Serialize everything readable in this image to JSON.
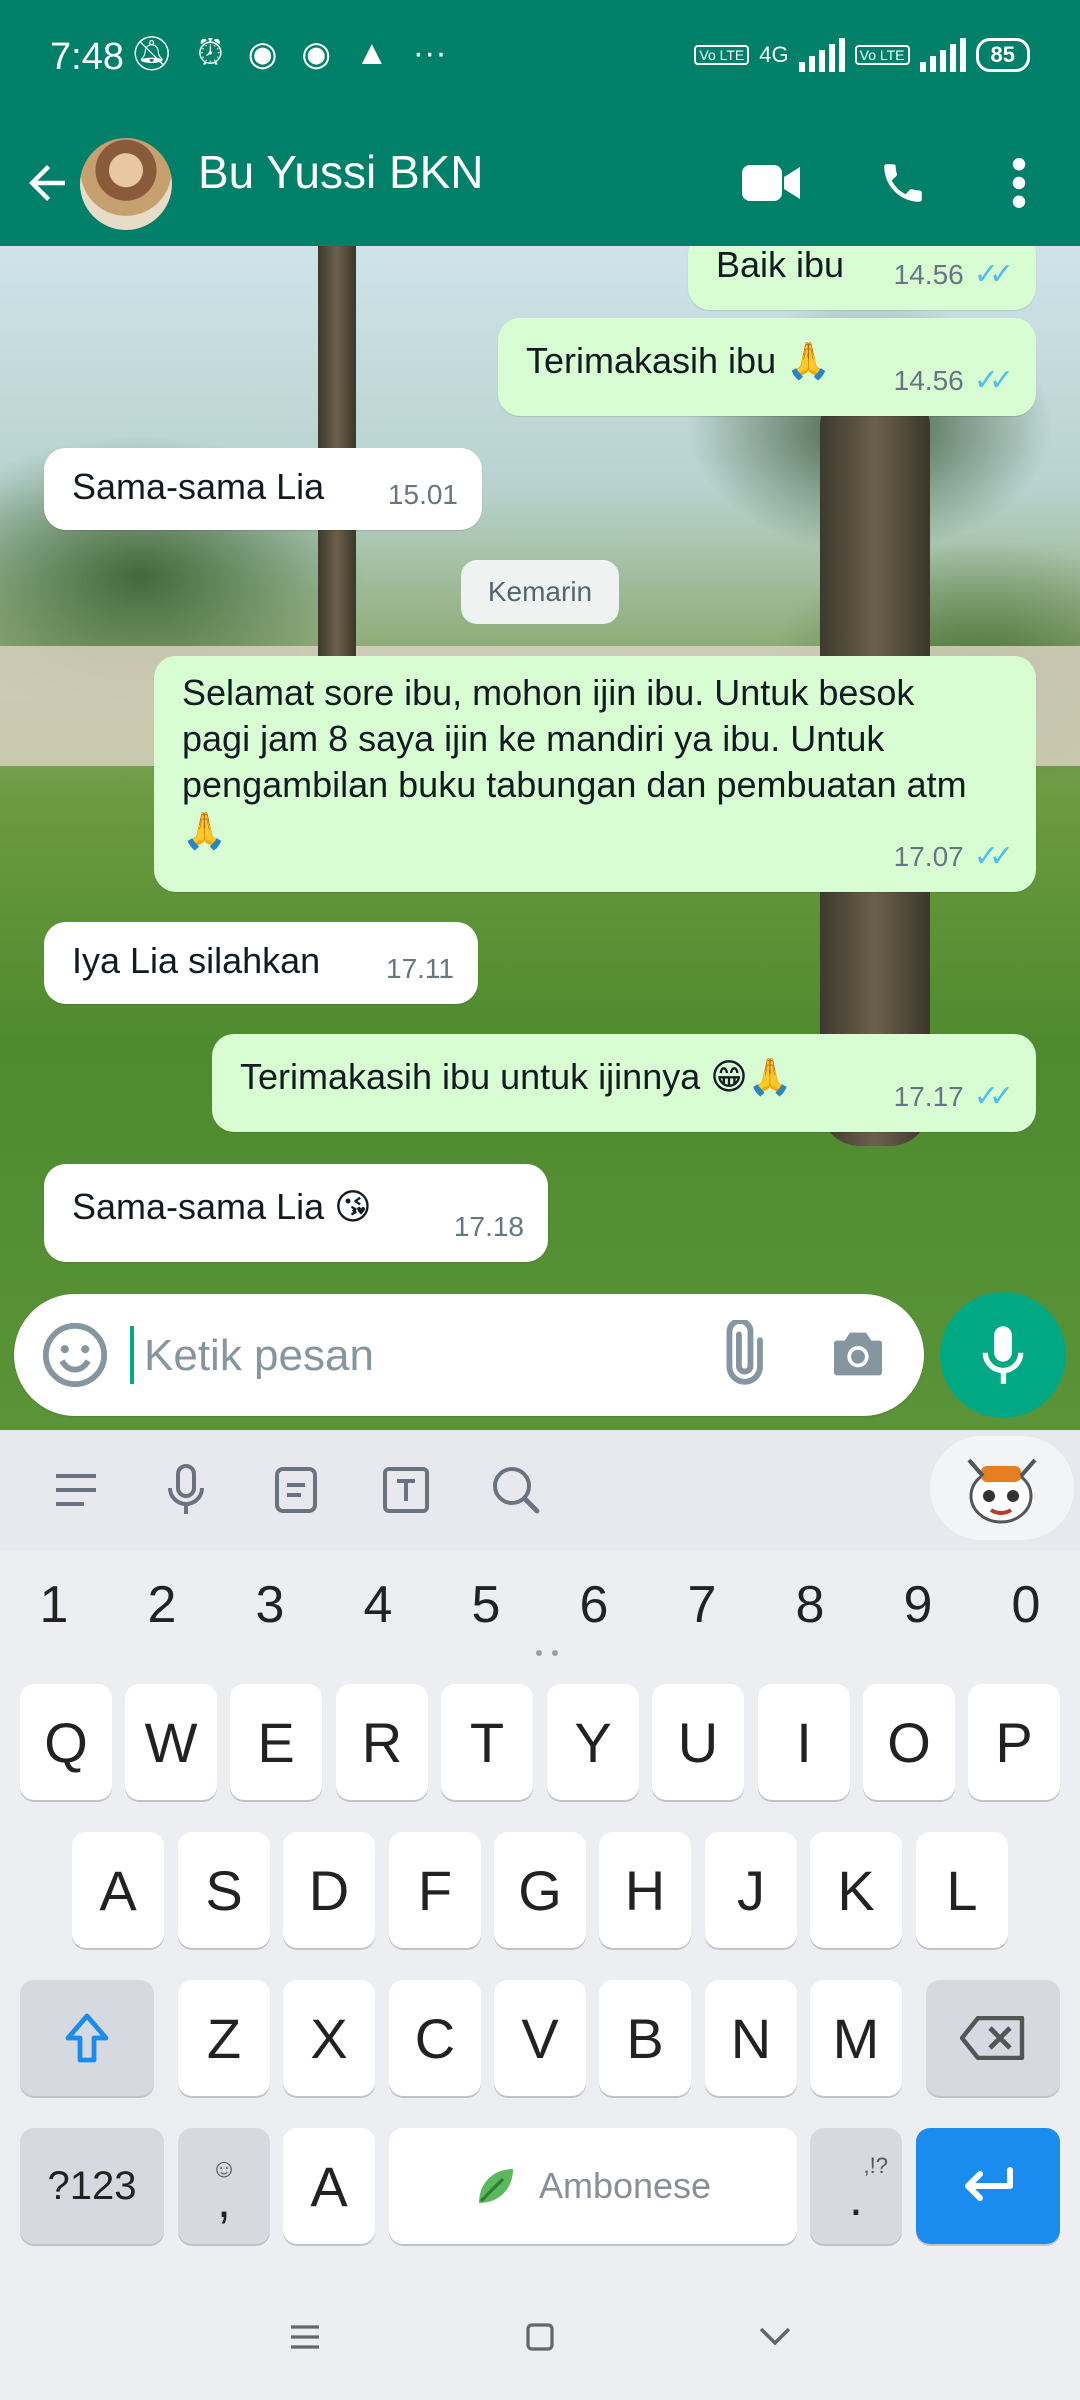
{
  "status": {
    "time": "7:48",
    "icons": [
      "mute-icon",
      "alarm-icon",
      "chrome-icon",
      "chrome-icon",
      "rocket-icon",
      "more-dots-icon"
    ],
    "network": "4G",
    "lte_label": "Vo LTE",
    "battery": "85"
  },
  "header": {
    "contact_name": "Bu Yussi BKN",
    "color": "#008069"
  },
  "messages": [
    {
      "direction": "out",
      "text": "Baik ibu",
      "time": "14.56",
      "read": true
    },
    {
      "direction": "out",
      "text": "Terimakasih ibu 🙏",
      "time": "14.56",
      "read": true
    },
    {
      "direction": "in",
      "text": "Sama-sama Lia",
      "time": "15.01"
    },
    {
      "direction": "out",
      "text": "Selamat sore ibu, mohon ijin ibu. Untuk besok pagi jam 8 saya ijin ke mandiri ya ibu. Untuk pengambilan buku tabungan dan pembuatan atm 🙏",
      "time": "17.07",
      "read": true
    },
    {
      "direction": "in",
      "text": "Iya Lia silahkan",
      "time": "17.11"
    },
    {
      "direction": "out",
      "text": "Terimakasih ibu untuk ijinnya 😁🙏",
      "time": "17.17",
      "read": true
    },
    {
      "direction": "in",
      "text": "Sama-sama Lia 😘",
      "time": "17.18"
    }
  ],
  "date_divider": "Kemarin",
  "composer": {
    "placeholder": "Ketik pesan",
    "value": ""
  },
  "keyboard": {
    "numbers": [
      "1",
      "2",
      "3",
      "4",
      "5",
      "6",
      "7",
      "8",
      "9",
      "0"
    ],
    "row1": [
      "Q",
      "W",
      "E",
      "R",
      "T",
      "Y",
      "U",
      "I",
      "O",
      "P"
    ],
    "row2": [
      "A",
      "S",
      "D",
      "F",
      "G",
      "H",
      "J",
      "K",
      "L"
    ],
    "row3": [
      "Z",
      "X",
      "C",
      "V",
      "B",
      "N",
      "M"
    ],
    "symbols_key": "?123",
    "comma_key": ",",
    "lang_key": "A",
    "space_label": "Ambonese",
    "period_key": ".",
    "period_hint": ",!?"
  },
  "colors": {
    "accent": "#00a884",
    "outgoing_bubble": "#d9fdd3",
    "read_ticks": "#53bdeb",
    "enter_key": "#1a8cf0"
  }
}
